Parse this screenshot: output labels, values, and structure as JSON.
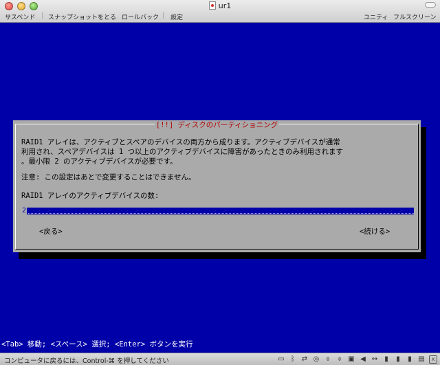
{
  "window": {
    "title": "ur1",
    "toolbar": {
      "suspend": "サスペンド",
      "snapshot": "スナップショットをとる",
      "rollback": "ロールバック",
      "settings": "設定",
      "unity": "ユニティ",
      "fullscreen": "フルスクリーン"
    }
  },
  "dialog": {
    "title": "[!!] ディスクのパーティショニング",
    "message": "RAID1 アレイは、アクティブとスペアのデバイスの両方から成ります。アクティブデバイスが通常\n利用され、スペアデバイスは 1 つ以上のアクティブデバイスに障害があったときのみ利用されます\n。最小限 2 のアクティブデバイスが必要です。",
    "note": "注意: この設定はあとで変更することはできません。",
    "prompt": "RAID1 アレイのアクティブデバイスの数:",
    "input_value": "2",
    "back_button": "<戻る>",
    "continue_button": "<続ける>"
  },
  "key_help": "<Tab> 移動; <スペース> 選択; <Enter> ボタンを実行",
  "statusbar": {
    "text": "コンピュータに戻るには、Control-⌘ を押してください",
    "icons": [
      "hdd-icon",
      "bluetooth-icon",
      "network-icon",
      "cd-icon",
      "usb-icon",
      "usb-icon",
      "camera-icon",
      "sound-icon",
      "arrows-icon",
      "usb-device-icon",
      "usb-device-icon",
      "usb-device-icon",
      "floppy-icon",
      "display-icon"
    ]
  },
  "colors": {
    "screen_bg": "#0000a8",
    "dialog_bg": "#aaaaaa",
    "dialog_title": "#b00000",
    "input_bg": "#0000a8"
  }
}
